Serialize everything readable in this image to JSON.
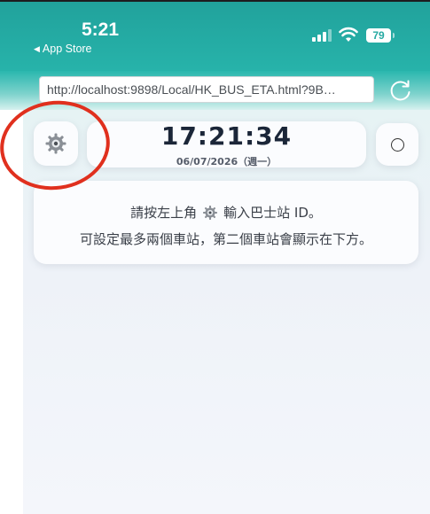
{
  "status_bar": {
    "time": "5:21",
    "back_label": "App Store",
    "battery": "79"
  },
  "browser": {
    "url": "http://localhost:9898/Local/HK_BUS_ETA.html?9B…"
  },
  "clock": {
    "time": "17:21:34",
    "date": "06/07/2026（週一）"
  },
  "info": {
    "line1_before": "請按左上角",
    "line1_after": "輸入巴士站 ID。",
    "line2": "可設定最多兩個車站，第二個車站會顯示在下方。"
  },
  "colors": {
    "accent": "#26a9a2",
    "annotation": "#e0301e"
  }
}
